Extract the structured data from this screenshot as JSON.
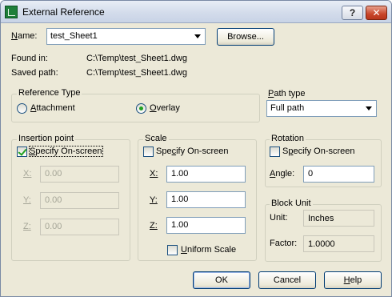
{
  "window": {
    "title": "External Reference",
    "help_button": "?",
    "close_button": "✕"
  },
  "name": {
    "label": "Name:",
    "value": "test_Sheet1",
    "browse_label": "Browse..."
  },
  "found_in": {
    "label": "Found in:",
    "value": "C:\\Temp\\test_Sheet1.dwg"
  },
  "saved_path": {
    "label": "Saved path:",
    "value": "C:\\Temp\\test_Sheet1.dwg"
  },
  "reference_type": {
    "title": "Reference Type",
    "options": [
      {
        "label": "Attachment",
        "selected": false
      },
      {
        "label": "Overlay",
        "selected": true
      }
    ]
  },
  "path_type": {
    "title": "Path type",
    "value": "Full path"
  },
  "insertion_point": {
    "title": "Insertion point",
    "specify_label": "Specify On-screen",
    "specify_checked": true,
    "x_label": "X:",
    "x_value": "0.00",
    "y_label": "Y:",
    "y_value": "0.00",
    "z_label": "Z:",
    "z_value": "0.00"
  },
  "scale": {
    "title": "Scale",
    "specify_label": "Specify On-screen",
    "specify_checked": false,
    "x_label": "X:",
    "x_value": "1.00",
    "y_label": "Y:",
    "y_value": "1.00",
    "z_label": "Z:",
    "z_value": "1.00",
    "uniform_label": "Uniform Scale",
    "uniform_checked": false
  },
  "rotation": {
    "title": "Rotation",
    "specify_label": "Specify On-screen",
    "specify_checked": false,
    "angle_label": "Angle:",
    "angle_value": "0"
  },
  "block_unit": {
    "title": "Block Unit",
    "unit_label": "Unit:",
    "unit_value": "Inches",
    "factor_label": "Factor:",
    "factor_value": "1.0000"
  },
  "buttons": {
    "ok": "OK",
    "cancel": "Cancel",
    "help": "Help"
  },
  "colors": {
    "check_green": "#21a121",
    "title_bg": "#d3dceb",
    "dialog_bg": "#ece9d8",
    "close_red": "#c8452a"
  }
}
